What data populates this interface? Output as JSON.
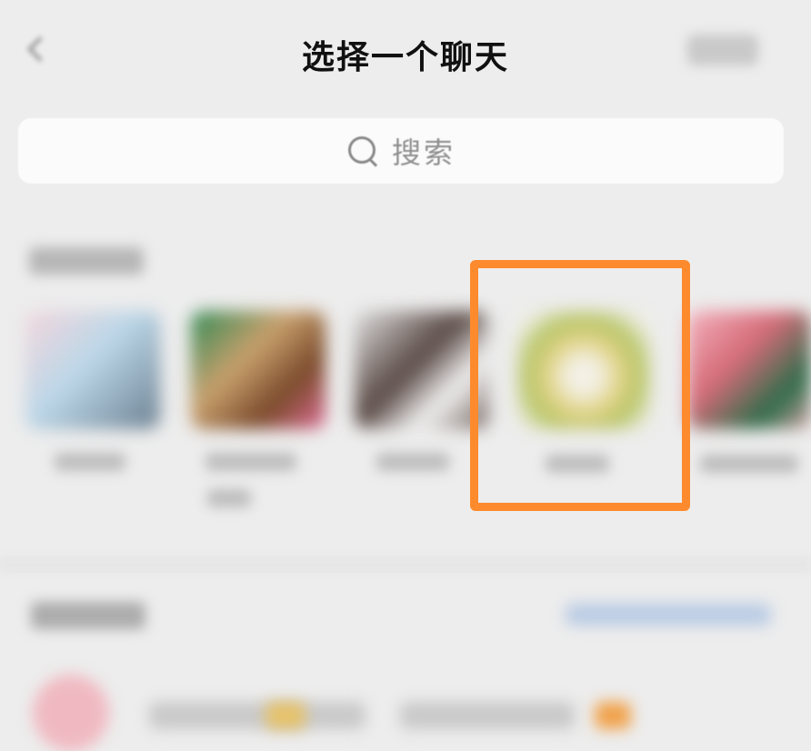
{
  "header": {
    "title": "选择一个聊天"
  },
  "search": {
    "placeholder": "搜索",
    "icon": "search-icon"
  },
  "colors": {
    "highlight": "#fd8a2c",
    "background": "#ededed"
  }
}
